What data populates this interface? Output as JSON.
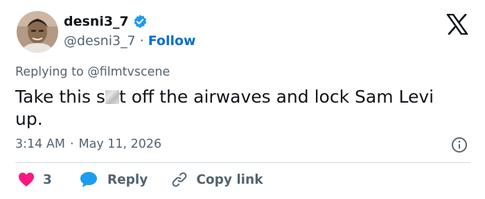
{
  "author": {
    "display_name": "desni3_7",
    "handle": "@desni3_7",
    "separator": "·",
    "follow_label": "Follow"
  },
  "reply": {
    "prefix": "Replying to",
    "mention": "@filmtvscene"
  },
  "tweet": {
    "text_before": "Take this s",
    "text_after": "t off the airwaves and lock Sam Levi up."
  },
  "meta": {
    "time": "3:14 AM",
    "separator": "·",
    "date": "May 11, 2026"
  },
  "actions": {
    "like_count": "3",
    "reply_label": "Reply",
    "copy_label": "Copy link"
  },
  "colors": {
    "like": "#f91880",
    "reply": "#1d9bf0",
    "follow": "#006fd6",
    "verified": "#1d9bf0",
    "muted": "#536471"
  },
  "icons": [
    "verified-badge-icon",
    "x-logo-icon",
    "info-icon",
    "heart-icon",
    "speech-bubble-icon",
    "link-icon"
  ]
}
